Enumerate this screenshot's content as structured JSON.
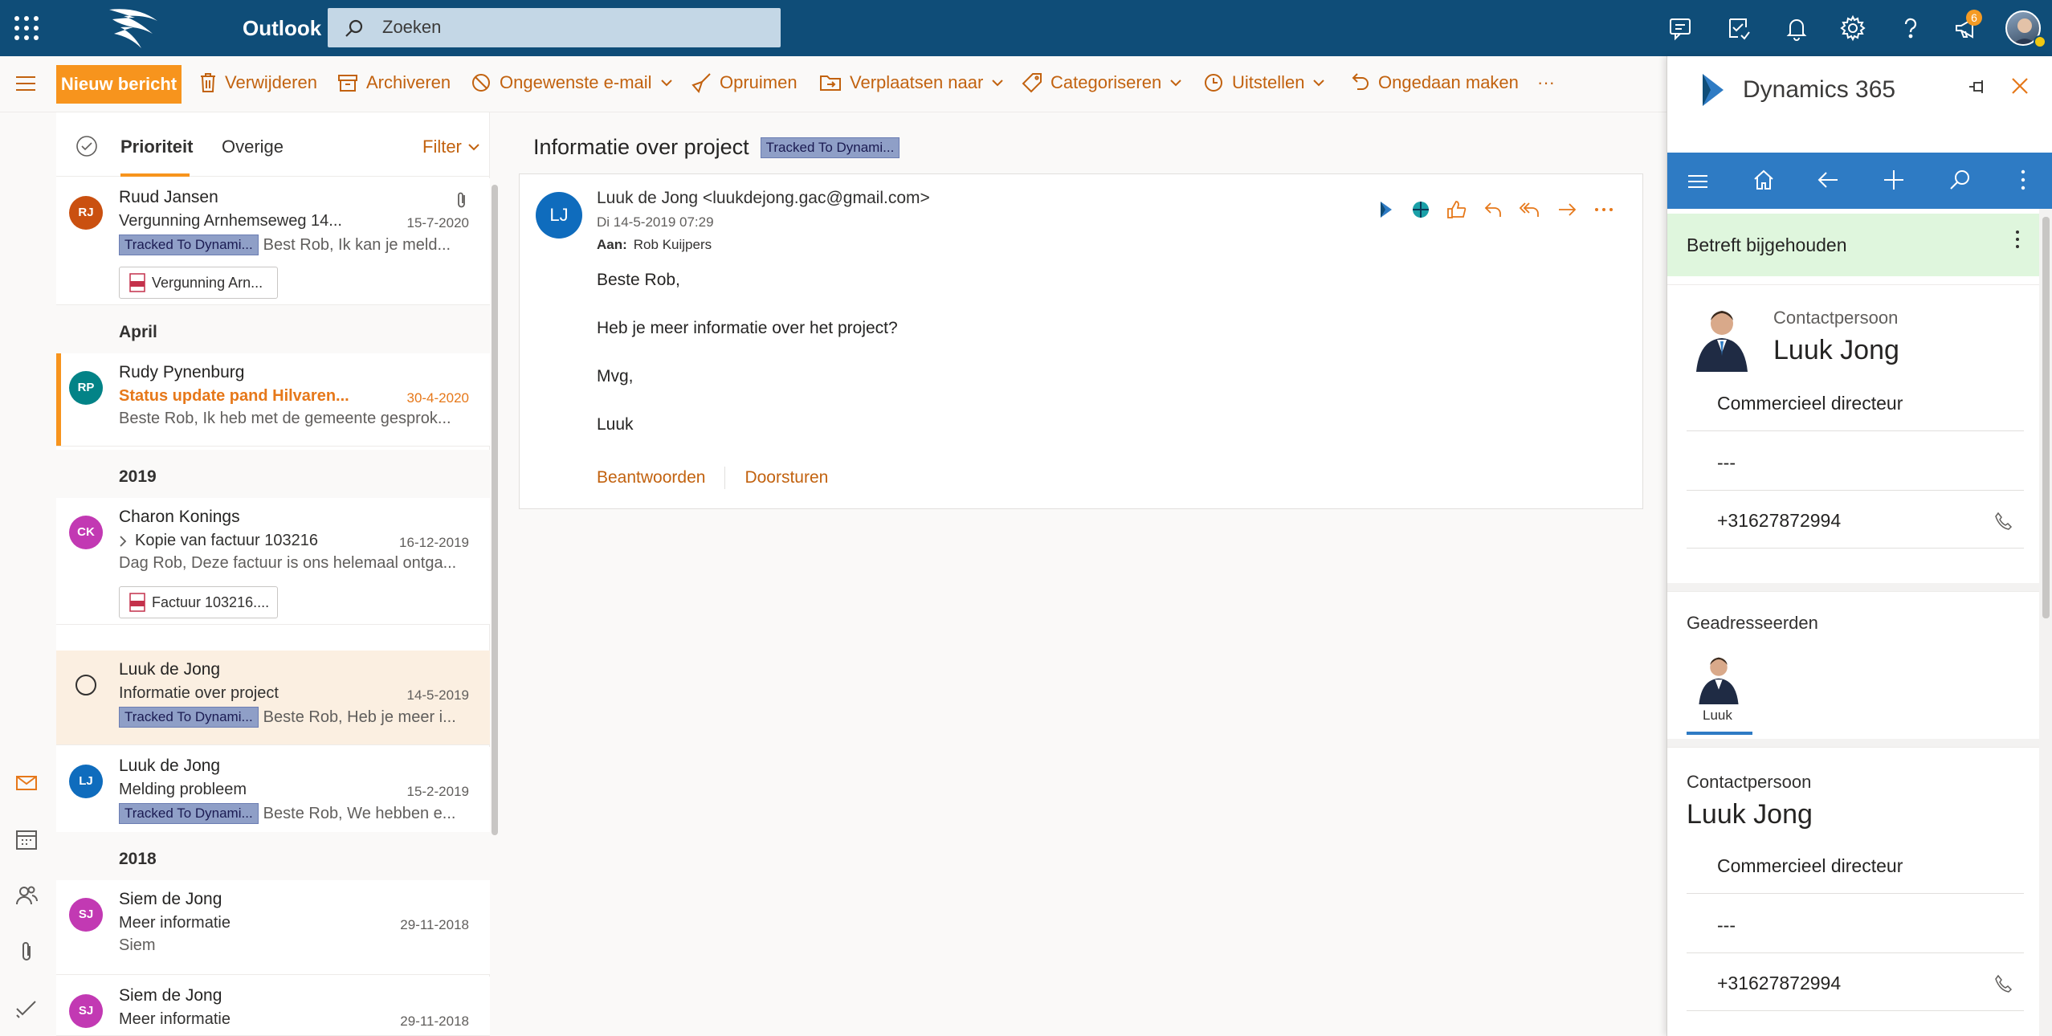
{
  "topbar": {
    "app_name": "Outlook",
    "search_placeholder": "Zoeken",
    "notification_count": "6"
  },
  "command_bar": {
    "new_message": "Nieuw bericht",
    "delete": "Verwijderen",
    "archive": "Archiveren",
    "junk": "Ongewenste e-mail",
    "sweep": "Opruimen",
    "move_to": "Verplaatsen naar",
    "categorize": "Categoriseren",
    "snooze": "Uitstellen",
    "undo": "Ongedaan maken",
    "more": "···"
  },
  "message_list": {
    "tabs": [
      "Prioriteit",
      "Overige"
    ],
    "filter": "Filter",
    "sections": [
      "April",
      "2019",
      "2018"
    ],
    "tag_text": "Tracked To Dynami...",
    "messages": [
      {
        "initials": "RJ",
        "avatar_color": "#ca5010",
        "sender": "Ruud Jansen",
        "subject": "Vergunning Arnhemseweg 14...",
        "date": "15-7-2020",
        "preview": "Best Rob, Ik kan je meld...",
        "attachment": "Vergunning Arn..."
      },
      {
        "initials": "RP",
        "avatar_color": "#038387",
        "sender": "Rudy Pynenburg",
        "subject": "Status update pand Hilvaren...",
        "date": "30-4-2020",
        "preview": "Beste Rob, Ik heb met de gemeente gesprok..."
      },
      {
        "initials": "CK",
        "avatar_color": "#c239b3",
        "sender": "Charon Konings",
        "subject": "Kopie van factuur 103216",
        "date": "16-12-2019",
        "preview": "Dag Rob, Deze factuur is ons helemaal ontga...",
        "attachment": "Factuur 103216...."
      },
      {
        "initials": "",
        "avatar_color": "#ffffff",
        "sender": "Luuk de Jong",
        "subject": "Informatie over project",
        "date": "14-5-2019",
        "preview": "Beste Rob, Heb je meer i..."
      },
      {
        "initials": "LJ",
        "avatar_color": "#0f6cbd",
        "sender": "Luuk de Jong",
        "subject": "Melding probleem",
        "date": "15-2-2019",
        "preview": "Beste Rob, We hebben e..."
      },
      {
        "initials": "SJ",
        "avatar_color": "#c239b3",
        "sender": "Siem de Jong",
        "subject": "Meer informatie",
        "date": "29-11-2018",
        "preview": "Siem"
      },
      {
        "initials": "SJ",
        "avatar_color": "#c239b3",
        "sender": "Siem de Jong",
        "subject": "Meer informatie",
        "date": "29-11-2018",
        "preview": ""
      }
    ]
  },
  "reading_pane": {
    "subject": "Informatie over project",
    "tag": "Tracked To Dynami...",
    "sender_initials": "LJ",
    "from": "Luuk de Jong <luukdejong.gac@gmail.com>",
    "sent": "Di 14-5-2019 07:29",
    "to_label": "Aan:",
    "to": "Rob Kuijpers",
    "body": [
      "Beste Rob,",
      "Heb je meer informatie over het project?",
      "Mvg,",
      "Luuk"
    ],
    "reply": "Beantwoorden",
    "forward": "Doorsturen"
  },
  "dynamics": {
    "title": "Dynamics 365",
    "regarding": "Betreft bijgehouden",
    "contact_label": "Contactpersoon",
    "contact_name": "Luuk Jong",
    "job_title": "Commercieel directeur",
    "empty_field": "---",
    "phone": "+31627872994",
    "recipients_label": "Geadresseerden",
    "recipient_name": "Luuk"
  }
}
